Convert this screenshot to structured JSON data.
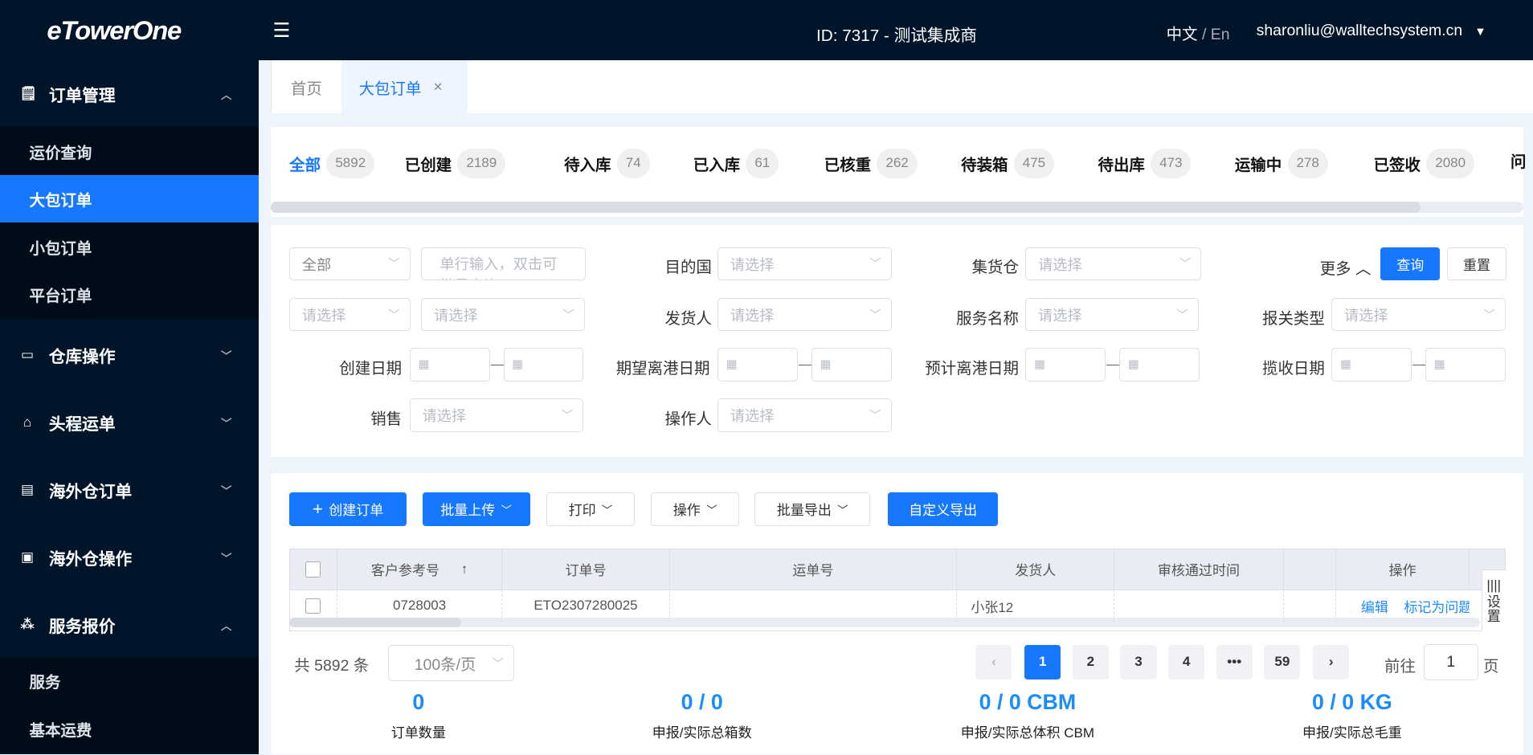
{
  "app": {
    "logo": "eTowerOne",
    "header_id": "ID: 7317 - 测试集成商",
    "lang_cn": "中文",
    "lang_sep": " / ",
    "lang_en": "En",
    "user": "sharonliu@walltechsystem.cn"
  },
  "sidebar": {
    "groups": [
      {
        "label": "订单管理",
        "icon": "clipboard-icon",
        "expanded": true,
        "items": [
          "运价查询",
          "大包订单",
          "小包订单",
          "平台订单"
        ],
        "active": "大包订单"
      },
      {
        "label": "仓库操作",
        "icon": "warehouse-icon",
        "expanded": false
      },
      {
        "label": "头程运单",
        "icon": "bag-icon",
        "expanded": false
      },
      {
        "label": "海外仓订单",
        "icon": "document-icon",
        "expanded": false
      },
      {
        "label": "海外仓操作",
        "icon": "box-icon",
        "expanded": false
      },
      {
        "label": "服务报价",
        "icon": "network-icon",
        "expanded": true,
        "items": [
          "服务",
          "基本运费"
        ]
      }
    ]
  },
  "tabs": [
    {
      "label": "首页",
      "active": false
    },
    {
      "label": "大包订单",
      "active": true,
      "closable": true
    }
  ],
  "status_tabs": [
    {
      "label": "全部",
      "count": "5892",
      "active": true
    },
    {
      "label": "已创建",
      "count": "2189"
    },
    {
      "label": "待入库",
      "count": "74"
    },
    {
      "label": "已入库",
      "count": "61"
    },
    {
      "label": "已核重",
      "count": "262"
    },
    {
      "label": "待装箱",
      "count": "475"
    },
    {
      "label": "待出库",
      "count": "473"
    },
    {
      "label": "运输中",
      "count": "278"
    },
    {
      "label": "已签收",
      "count": "2080"
    },
    {
      "label": "问"
    }
  ],
  "filters": {
    "type_select": "全部",
    "search_placeholder": "单行输入，双击可批量查询",
    "placeholder": "请选择",
    "labels": {
      "dest": "目的国",
      "warehouse": "集货仓",
      "shipper": "发货人",
      "service": "服务名称",
      "customs": "报关类型",
      "created": "创建日期",
      "etd_expected": "期望离港日期",
      "etd_planned": "预计离港日期",
      "pickup": "揽收日期",
      "sales": "销售",
      "operator": "操作人"
    },
    "more": "更多",
    "query": "查询",
    "reset": "重置"
  },
  "toolbar": {
    "create": "创建订单",
    "upload": "批量上传",
    "print": "打印",
    "operate": "操作",
    "export": "批量导出",
    "custom_export": "自定义导出"
  },
  "table": {
    "columns": [
      "客户参考号",
      "订单号",
      "运单号",
      "发货人",
      "审核通过时间",
      "",
      "操作"
    ],
    "settings": "设置",
    "rows": [
      {
        "ref": "0728003",
        "order": "ETO2307280025",
        "waybill": "",
        "shipper": "小张12",
        "approved": "",
        "actions": [
          "编辑",
          "标记为问题"
        ]
      }
    ]
  },
  "pagination": {
    "total": "共 5892 条",
    "page_size": "100条/页",
    "pages": [
      "1",
      "2",
      "3",
      "4",
      "•••",
      "59"
    ],
    "current": "1",
    "goto_label": "前往",
    "goto_value": "1",
    "page_suffix": "页"
  },
  "summary": [
    {
      "value": "0",
      "label": "订单数量"
    },
    {
      "value": "0 / 0",
      "label": "申报/实际总箱数"
    },
    {
      "value": "0 / 0 CBM",
      "label": "申报/实际总体积 CBM"
    },
    {
      "value": "0 / 0 KG",
      "label": "申报/实际总毛重"
    }
  ],
  "colors": {
    "primary": "#1677ff",
    "sidebar": "#001529",
    "link": "#1a8cff"
  }
}
